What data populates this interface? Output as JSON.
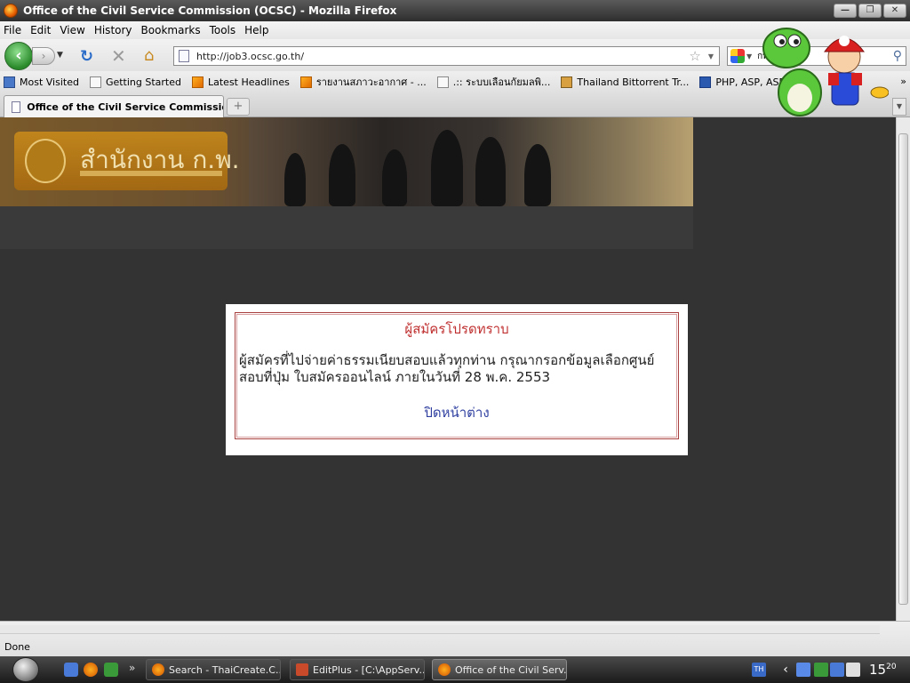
{
  "window": {
    "title": "Office of the Civil Service Commission (OCSC) - Mozilla Firefox",
    "controls": {
      "minimize": "—",
      "maximize": "❐",
      "close": "✕"
    }
  },
  "menu": [
    "File",
    "Edit",
    "View",
    "History",
    "Bookmarks",
    "Tools",
    "Help"
  ],
  "nav": {
    "url": "http://job3.ocsc.go.th/",
    "search_query": "กพ"
  },
  "bookmarks": [
    {
      "label": "Most Visited",
      "icon": "bookmark-icon"
    },
    {
      "label": "Getting Started",
      "icon": "page-icon"
    },
    {
      "label": "Latest Headlines",
      "icon": "rss-icon"
    },
    {
      "label": "รายงานสภาวะอากาศ - ...",
      "icon": "rss-icon"
    },
    {
      "label": ".:: ระบบเลือนกัยมลพิ...",
      "icon": "page-icon"
    },
    {
      "label": "Thailand Bittorrent Tr...",
      "icon": "torrent-icon"
    },
    {
      "label": "PHP, ASP, ASP.NET, ...",
      "icon": "web-icon"
    }
  ],
  "tab": {
    "label": "Office of the Civil Service Commissio..."
  },
  "page": {
    "banner_title": "สำนักงาน ก.พ.",
    "modal": {
      "title": "ผู้สมัครโปรดทราบ",
      "body": "ผู้สมัครที่ไปจ่ายค่าธรรมเนียบสอบแล้วทุกท่าน กรุณากรอกข้อมูลเลือกศูนย์สอบที่ปุ่ม ใบสมัครออนไลน์ ภายในวันที่ 28 พ.ค. 2553",
      "close_link": "ปิดหน้าต่าง"
    }
  },
  "status": {
    "text": "Done"
  },
  "taskbar": {
    "tasks": [
      {
        "label": "Search - ThaiCreate.C...",
        "active": false
      },
      {
        "label": "EditPlus - [C:\\AppServ...",
        "active": false
      },
      {
        "label": "Office of the Civil Serv...",
        "active": true
      }
    ],
    "language": "TH",
    "clock_hour": "15",
    "clock_minute": "20"
  },
  "colors": {
    "content_bg": "#333333",
    "modal_title": "#c03030",
    "modal_link": "#3040a0"
  }
}
